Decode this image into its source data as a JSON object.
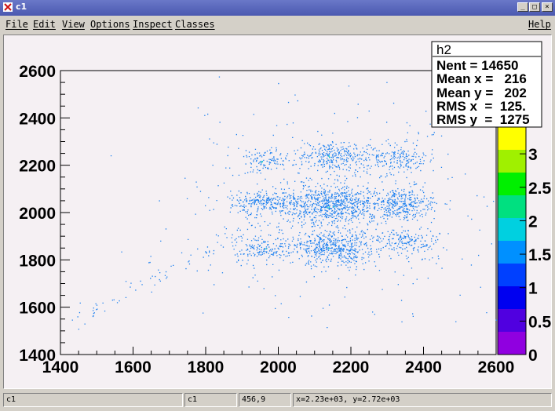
{
  "window": {
    "title": "c1",
    "min_label": "_",
    "max_label": "□",
    "close_label": "×"
  },
  "menu": {
    "items": [
      "File",
      "Edit",
      "View",
      "Options",
      "Inspect",
      "Classes"
    ],
    "help": "Help"
  },
  "stats": {
    "name": "h2",
    "lines": [
      "Nent = 14650",
      "Mean x =   216",
      "Mean y =   202",
      "RMS x  =  125.",
      "RMS y  =  1275"
    ]
  },
  "palette": {
    "labels": [
      "3",
      "2.5",
      "2",
      "1.5",
      "1",
      "0.5",
      "0"
    ],
    "colors": [
      "#ffff00",
      "#a0f000",
      "#00f000",
      "#00e080",
      "#00d0e0",
      "#0090ff",
      "#0040ff",
      "#0000f0",
      "#5000e0",
      "#9000e0"
    ]
  },
  "chart_data": {
    "type": "heatmap",
    "title": "",
    "xlabel": "",
    "ylabel": "",
    "xlim": [
      1400,
      2600
    ],
    "ylim": [
      1400,
      2600
    ],
    "x_ticks": [
      "1400",
      "1600",
      "1800",
      "2000",
      "2200",
      "2400",
      "2600"
    ],
    "y_ticks": [
      "1400",
      "1600",
      "1800",
      "2000",
      "2200",
      "2400",
      "2600"
    ],
    "z_range": [
      0,
      3.4
    ],
    "point_color": "#1a7ff0",
    "dense_color": "#00c8c0",
    "clusters": [
      {
        "x": 2150,
        "y": 2030,
        "sx": 65,
        "sy": 40,
        "weight": 0.22
      },
      {
        "x": 2150,
        "y": 1850,
        "sx": 55,
        "sy": 35,
        "weight": 0.15
      },
      {
        "x": 2150,
        "y": 2240,
        "sx": 50,
        "sy": 30,
        "weight": 0.09
      },
      {
        "x": 1960,
        "y": 2040,
        "sx": 50,
        "sy": 25,
        "weight": 0.08
      },
      {
        "x": 2340,
        "y": 2040,
        "sx": 45,
        "sy": 35,
        "weight": 0.1
      },
      {
        "x": 1960,
        "y": 1845,
        "sx": 40,
        "sy": 25,
        "weight": 0.05
      },
      {
        "x": 2330,
        "y": 2230,
        "sx": 40,
        "sy": 30,
        "weight": 0.05
      },
      {
        "x": 1960,
        "y": 2220,
        "sx": 30,
        "sy": 25,
        "weight": 0.03
      },
      {
        "x": 2350,
        "y": 1880,
        "sx": 50,
        "sy": 30,
        "weight": 0.06
      },
      {
        "x": 2150,
        "y": 2040,
        "sx": 220,
        "sy": 220,
        "weight": 0.12
      }
    ],
    "diagonal_band": {
      "x_from": 1430,
      "x_to": 2580,
      "slope": 0.82,
      "intercept_at_2000": 2000,
      "spread": 25,
      "weight": 0.05
    }
  },
  "status": {
    "object": "c1",
    "canvas": "c1",
    "pixel": "456,9",
    "coords": "x=2.23e+03, y=2.72e+03"
  }
}
